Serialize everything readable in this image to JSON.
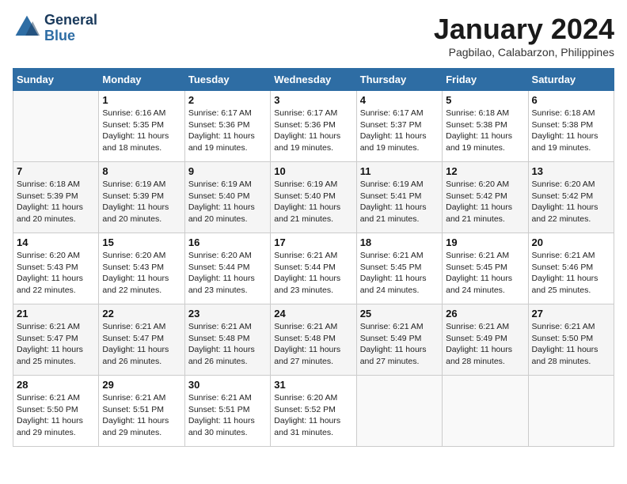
{
  "logo": {
    "line1": "General",
    "line2": "Blue"
  },
  "title": "January 2024",
  "subtitle": "Pagbilao, Calabarzon, Philippines",
  "days_of_week": [
    "Sunday",
    "Monday",
    "Tuesday",
    "Wednesday",
    "Thursday",
    "Friday",
    "Saturday"
  ],
  "weeks": [
    [
      {
        "num": "",
        "info": ""
      },
      {
        "num": "1",
        "info": "Sunrise: 6:16 AM\nSunset: 5:35 PM\nDaylight: 11 hours\nand 18 minutes."
      },
      {
        "num": "2",
        "info": "Sunrise: 6:17 AM\nSunset: 5:36 PM\nDaylight: 11 hours\nand 19 minutes."
      },
      {
        "num": "3",
        "info": "Sunrise: 6:17 AM\nSunset: 5:36 PM\nDaylight: 11 hours\nand 19 minutes."
      },
      {
        "num": "4",
        "info": "Sunrise: 6:17 AM\nSunset: 5:37 PM\nDaylight: 11 hours\nand 19 minutes."
      },
      {
        "num": "5",
        "info": "Sunrise: 6:18 AM\nSunset: 5:38 PM\nDaylight: 11 hours\nand 19 minutes."
      },
      {
        "num": "6",
        "info": "Sunrise: 6:18 AM\nSunset: 5:38 PM\nDaylight: 11 hours\nand 19 minutes."
      }
    ],
    [
      {
        "num": "7",
        "info": "Sunrise: 6:18 AM\nSunset: 5:39 PM\nDaylight: 11 hours\nand 20 minutes."
      },
      {
        "num": "8",
        "info": "Sunrise: 6:19 AM\nSunset: 5:39 PM\nDaylight: 11 hours\nand 20 minutes."
      },
      {
        "num": "9",
        "info": "Sunrise: 6:19 AM\nSunset: 5:40 PM\nDaylight: 11 hours\nand 20 minutes."
      },
      {
        "num": "10",
        "info": "Sunrise: 6:19 AM\nSunset: 5:40 PM\nDaylight: 11 hours\nand 21 minutes."
      },
      {
        "num": "11",
        "info": "Sunrise: 6:19 AM\nSunset: 5:41 PM\nDaylight: 11 hours\nand 21 minutes."
      },
      {
        "num": "12",
        "info": "Sunrise: 6:20 AM\nSunset: 5:42 PM\nDaylight: 11 hours\nand 21 minutes."
      },
      {
        "num": "13",
        "info": "Sunrise: 6:20 AM\nSunset: 5:42 PM\nDaylight: 11 hours\nand 22 minutes."
      }
    ],
    [
      {
        "num": "14",
        "info": "Sunrise: 6:20 AM\nSunset: 5:43 PM\nDaylight: 11 hours\nand 22 minutes."
      },
      {
        "num": "15",
        "info": "Sunrise: 6:20 AM\nSunset: 5:43 PM\nDaylight: 11 hours\nand 22 minutes."
      },
      {
        "num": "16",
        "info": "Sunrise: 6:20 AM\nSunset: 5:44 PM\nDaylight: 11 hours\nand 23 minutes."
      },
      {
        "num": "17",
        "info": "Sunrise: 6:21 AM\nSunset: 5:44 PM\nDaylight: 11 hours\nand 23 minutes."
      },
      {
        "num": "18",
        "info": "Sunrise: 6:21 AM\nSunset: 5:45 PM\nDaylight: 11 hours\nand 24 minutes."
      },
      {
        "num": "19",
        "info": "Sunrise: 6:21 AM\nSunset: 5:45 PM\nDaylight: 11 hours\nand 24 minutes."
      },
      {
        "num": "20",
        "info": "Sunrise: 6:21 AM\nSunset: 5:46 PM\nDaylight: 11 hours\nand 25 minutes."
      }
    ],
    [
      {
        "num": "21",
        "info": "Sunrise: 6:21 AM\nSunset: 5:47 PM\nDaylight: 11 hours\nand 25 minutes."
      },
      {
        "num": "22",
        "info": "Sunrise: 6:21 AM\nSunset: 5:47 PM\nDaylight: 11 hours\nand 26 minutes."
      },
      {
        "num": "23",
        "info": "Sunrise: 6:21 AM\nSunset: 5:48 PM\nDaylight: 11 hours\nand 26 minutes."
      },
      {
        "num": "24",
        "info": "Sunrise: 6:21 AM\nSunset: 5:48 PM\nDaylight: 11 hours\nand 27 minutes."
      },
      {
        "num": "25",
        "info": "Sunrise: 6:21 AM\nSunset: 5:49 PM\nDaylight: 11 hours\nand 27 minutes."
      },
      {
        "num": "26",
        "info": "Sunrise: 6:21 AM\nSunset: 5:49 PM\nDaylight: 11 hours\nand 28 minutes."
      },
      {
        "num": "27",
        "info": "Sunrise: 6:21 AM\nSunset: 5:50 PM\nDaylight: 11 hours\nand 28 minutes."
      }
    ],
    [
      {
        "num": "28",
        "info": "Sunrise: 6:21 AM\nSunset: 5:50 PM\nDaylight: 11 hours\nand 29 minutes."
      },
      {
        "num": "29",
        "info": "Sunrise: 6:21 AM\nSunset: 5:51 PM\nDaylight: 11 hours\nand 29 minutes."
      },
      {
        "num": "30",
        "info": "Sunrise: 6:21 AM\nSunset: 5:51 PM\nDaylight: 11 hours\nand 30 minutes."
      },
      {
        "num": "31",
        "info": "Sunrise: 6:20 AM\nSunset: 5:52 PM\nDaylight: 11 hours\nand 31 minutes."
      },
      {
        "num": "",
        "info": ""
      },
      {
        "num": "",
        "info": ""
      },
      {
        "num": "",
        "info": ""
      }
    ]
  ]
}
